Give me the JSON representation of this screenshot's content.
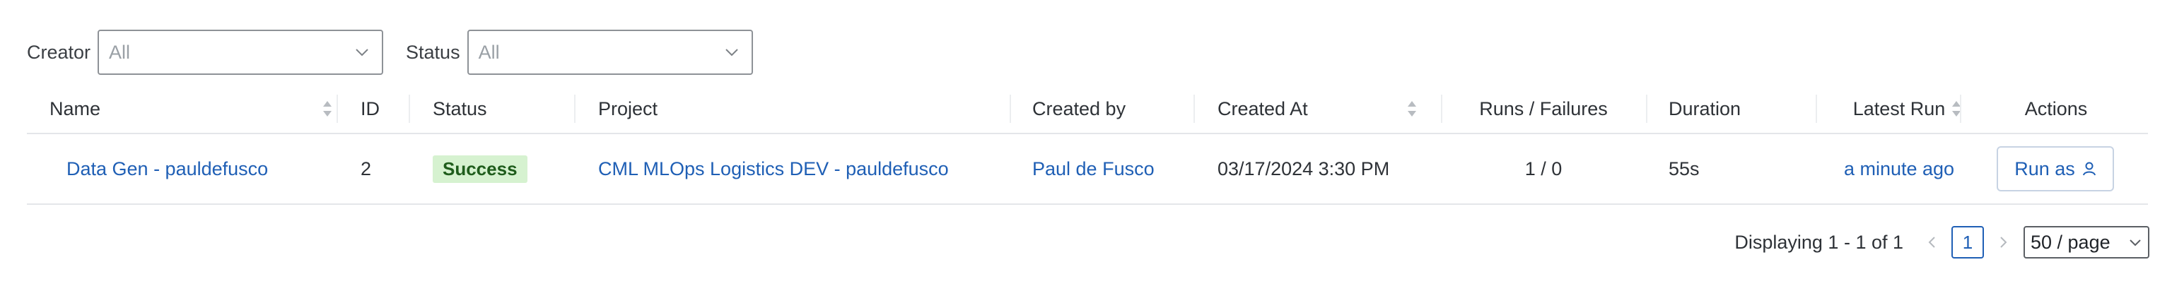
{
  "filters": {
    "creator": {
      "label": "Creator",
      "value": "All"
    },
    "status": {
      "label": "Status",
      "value": "All"
    }
  },
  "table": {
    "headers": {
      "name": "Name",
      "id": "ID",
      "status": "Status",
      "project": "Project",
      "created_by": "Created by",
      "created_at": "Created At",
      "runs_failures": "Runs / Failures",
      "duration": "Duration",
      "latest_run": "Latest Run",
      "actions": "Actions"
    },
    "rows": [
      {
        "name": "Data Gen - pauldefusco",
        "id": "2",
        "status": "Success",
        "project": "CML MLOps Logistics DEV - pauldefusco",
        "created_by": "Paul de Fusco",
        "created_at": "03/17/2024 3:30 PM",
        "runs_failures": "1 / 0",
        "duration": "55s",
        "latest_run": "a minute ago",
        "action_label": "Run as"
      }
    ]
  },
  "pagination": {
    "summary": "Displaying 1 - 1 of 1",
    "current_page": "1",
    "page_size": "50 / page"
  },
  "colors": {
    "link": "#1f5fb5",
    "success_bg": "#d6f2d0",
    "success_text": "#1f5d1c"
  },
  "icons": {
    "sort": "sort-icon",
    "chevron": "chevron-down-icon",
    "user": "user-icon",
    "prev": "chevron-left-icon",
    "next": "chevron-right-icon"
  }
}
